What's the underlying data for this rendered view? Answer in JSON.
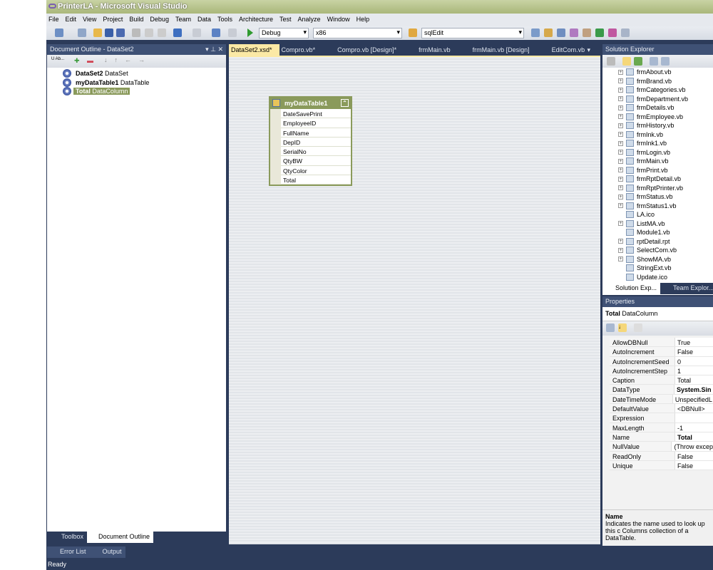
{
  "window": {
    "title": "PrinterLA - Microsoft Visual Studio"
  },
  "menu": [
    "File",
    "Edit",
    "View",
    "Project",
    "Build",
    "Debug",
    "Team",
    "Data",
    "Tools",
    "Architecture",
    "Test",
    "Analyze",
    "Window",
    "Help"
  ],
  "toolbar": {
    "config": "Debug",
    "platform": "x86",
    "find": "sqlEdit"
  },
  "outline": {
    "title": "Document Outline - DataSet2",
    "toolbar_label": "U Ab...",
    "items": [
      {
        "name": "DataSet2",
        "type": "DataSet"
      },
      {
        "name": "myDataTable1",
        "type": "DataTable"
      },
      {
        "name": "Total",
        "type": "DataColumn"
      }
    ]
  },
  "bottom_left_tabs": [
    "Toolbox",
    "Document Outline"
  ],
  "output_tabs": [
    "Error List",
    "Output"
  ],
  "editor_tabs": [
    "DataSet2.xsd*",
    "Compro.vb*",
    "Compro.vb [Design]*",
    "frmMain.vb",
    "frmMain.vb [Design]",
    "EditCom.vb"
  ],
  "datatable": {
    "name": "myDataTable1",
    "columns": [
      "DateSavePrint",
      "EmployeeID",
      "FullName",
      "DepID",
      "SerialNo",
      "QtyBW",
      "QtyColor",
      "Total"
    ]
  },
  "solution": {
    "title": "Solution Explorer",
    "items": [
      "frmAbout.vb",
      "frmBrand.vb",
      "frmCategories.vb",
      "frmDepartment.vb",
      "frmDetails.vb",
      "frmEmployee.vb",
      "frmHistory.vb",
      "frmInk.vb",
      "frmInk1.vb",
      "frmLogin.vb",
      "frmMain.vb",
      "frmPrint.vb",
      "frmRptDetail.vb",
      "frmRptPrinter.vb",
      "frmStatus.vb",
      "frmStatus1.vb",
      "LA.ico",
      "ListMA.vb",
      "Module1.vb",
      "rptDetail.rpt",
      "SelectCom.vb",
      "ShowMA.vb",
      "StringExt.vb",
      "Update.ico"
    ],
    "tabs": [
      "Solution Exp...",
      "Team Explor..."
    ]
  },
  "properties": {
    "title": "Properties",
    "object": "Total",
    "object_type": "DataColumn",
    "rows": [
      [
        "AllowDBNull",
        "True"
      ],
      [
        "AutoIncrement",
        "False"
      ],
      [
        "AutoIncrementSeed",
        "0"
      ],
      [
        "AutoIncrementStep",
        "1"
      ],
      [
        "Caption",
        "Total"
      ],
      [
        "DataType",
        "System.Sin"
      ],
      [
        "DateTimeMode",
        "UnspecifiedL"
      ],
      [
        "DefaultValue",
        "<DBNull>"
      ],
      [
        "Expression",
        ""
      ],
      [
        "MaxLength",
        "-1"
      ],
      [
        "Name",
        "Total"
      ],
      [
        "NullValue",
        "(Throw excep"
      ],
      [
        "ReadOnly",
        "False"
      ],
      [
        "Unique",
        "False"
      ]
    ],
    "desc_title": "Name",
    "desc_text": "Indicates the name used to look up this c Columns collection of a DataTable."
  },
  "status": "Ready"
}
